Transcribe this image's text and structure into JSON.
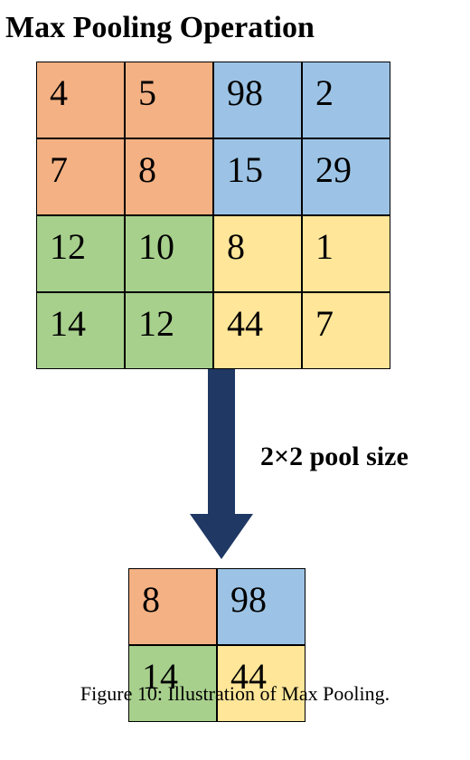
{
  "title": "Max Pooling Operation",
  "pool_label": "2×2 pool size",
  "caption": "Figure 10: Illustration of Max Pooling.",
  "colors": {
    "orange": "#f4b183",
    "blue": "#9cc3e5",
    "green": "#a8d08d",
    "yellow": "#ffe699",
    "arrow": "#1f3864"
  },
  "input_grid": {
    "rows": 4,
    "cols": 4,
    "cells": [
      [
        {
          "v": 4,
          "c": "orange"
        },
        {
          "v": 5,
          "c": "orange"
        },
        {
          "v": 98,
          "c": "blue"
        },
        {
          "v": 2,
          "c": "blue"
        }
      ],
      [
        {
          "v": 7,
          "c": "orange"
        },
        {
          "v": 8,
          "c": "orange"
        },
        {
          "v": 15,
          "c": "blue"
        },
        {
          "v": 29,
          "c": "blue"
        }
      ],
      [
        {
          "v": 12,
          "c": "green"
        },
        {
          "v": 10,
          "c": "green"
        },
        {
          "v": 8,
          "c": "yellow"
        },
        {
          "v": 1,
          "c": "yellow"
        }
      ],
      [
        {
          "v": 14,
          "c": "green"
        },
        {
          "v": 12,
          "c": "green"
        },
        {
          "v": 44,
          "c": "yellow"
        },
        {
          "v": 7,
          "c": "yellow"
        }
      ]
    ]
  },
  "output_grid": {
    "rows": 2,
    "cols": 2,
    "cells": [
      [
        {
          "v": 8,
          "c": "orange"
        },
        {
          "v": 98,
          "c": "blue"
        }
      ],
      [
        {
          "v": 14,
          "c": "green"
        },
        {
          "v": 44,
          "c": "yellow"
        }
      ]
    ]
  },
  "chart_data": {
    "type": "table",
    "description": "2×2 max pooling over a 4×4 input",
    "pool_size": [
      2,
      2
    ],
    "input": [
      [
        4,
        5,
        98,
        2
      ],
      [
        7,
        8,
        15,
        29
      ],
      [
        12,
        10,
        8,
        1
      ],
      [
        14,
        12,
        44,
        7
      ]
    ],
    "output": [
      [
        8,
        98
      ],
      [
        14,
        44
      ]
    ],
    "region_colors": {
      "top_left": "orange",
      "top_right": "blue",
      "bottom_left": "green",
      "bottom_right": "yellow"
    }
  }
}
